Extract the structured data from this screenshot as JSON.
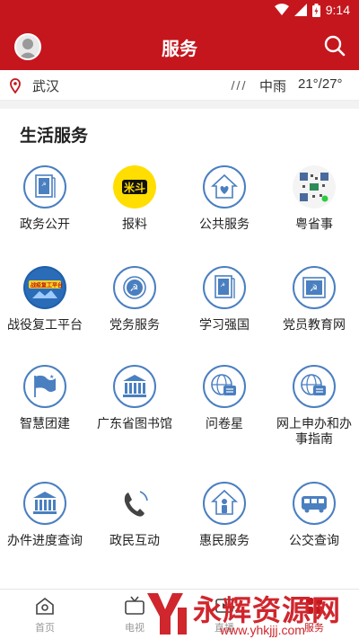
{
  "status_bar": {
    "time": "9:14"
  },
  "app_bar": {
    "title": "服务"
  },
  "weather": {
    "city": "武汉",
    "description": "中雨",
    "temperature": "21°/27°"
  },
  "section": {
    "title": "生活服务"
  },
  "services": [
    {
      "label": "政务公开",
      "icon": "gov-doc-icon"
    },
    {
      "label": "报料",
      "icon": "baoliao-logo-icon"
    },
    {
      "label": "公共服务",
      "icon": "heart-house-icon"
    },
    {
      "label": "粤省事",
      "icon": "qr-code-icon"
    },
    {
      "label": "战役复工平台",
      "icon": "fight-reopen-platform-icon",
      "badge_text": "战疫复工平台"
    },
    {
      "label": "党务服务",
      "icon": "party-emblem-icon"
    },
    {
      "label": "学习强国",
      "icon": "study-doc-icon"
    },
    {
      "label": "党员教育网",
      "icon": "party-flag-icon"
    },
    {
      "label": "智慧团建",
      "icon": "flag-icon"
    },
    {
      "label": "广东省图书馆",
      "icon": "library-building-icon"
    },
    {
      "label": "问卷星",
      "icon": "globe-chat-icon"
    },
    {
      "label": "网上申办和办事指南",
      "label_line1": "网上申办和办",
      "label_line2": "事指南",
      "icon": "globe-doc-icon"
    },
    {
      "label": "办件进度查询",
      "icon": "building-icon"
    },
    {
      "label": "政民互动",
      "icon": "phone-icon"
    },
    {
      "label": "惠民服务",
      "icon": "person-house-icon"
    },
    {
      "label": "公交查询",
      "icon": "bus-icon"
    }
  ],
  "bottom_nav": [
    {
      "label": "首页",
      "icon": "home-icon"
    },
    {
      "label": "电视",
      "icon": "tv-icon"
    },
    {
      "label": "直播",
      "icon": "live-icon"
    },
    {
      "label": "服务",
      "icon": "service-icon"
    }
  ],
  "watermark": {
    "brand": "永辉资源网",
    "url": "www.yhkjjj.com"
  },
  "colors": {
    "brand_red": "#c5161d",
    "icon_blue": "#4a7fc0"
  }
}
